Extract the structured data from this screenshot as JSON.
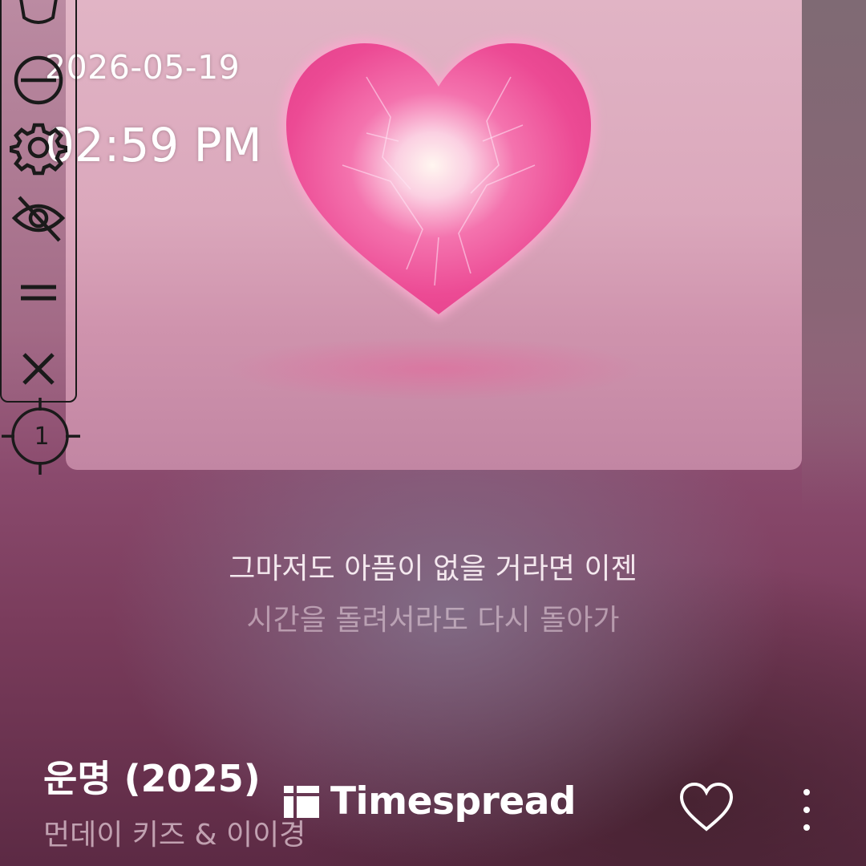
{
  "overlay": {
    "date": "2026-05-19",
    "time": "02:59 PM",
    "badge_number": "1"
  },
  "toolbar": {
    "items": [
      "shield-icon",
      "minus-circle-icon",
      "gear-icon",
      "eye-off-icon",
      "drag-handle-icon",
      "close-icon"
    ]
  },
  "player": {
    "lyrics": {
      "current": "그마저도 아픔이 없을 거라면 이젠",
      "next": "시간을 돌려서라도 다시 돌아가"
    },
    "track": {
      "title": "운명 (2025)",
      "artist": "먼데이 키즈 & 이이경"
    },
    "actions": [
      "heart-icon",
      "more-vertical-icon"
    ]
  },
  "watermark": {
    "text": "Timespread"
  },
  "colors": {
    "heart": "#ee4f97",
    "background_top": "#b9889f",
    "background_bottom": "#5c2a44"
  }
}
